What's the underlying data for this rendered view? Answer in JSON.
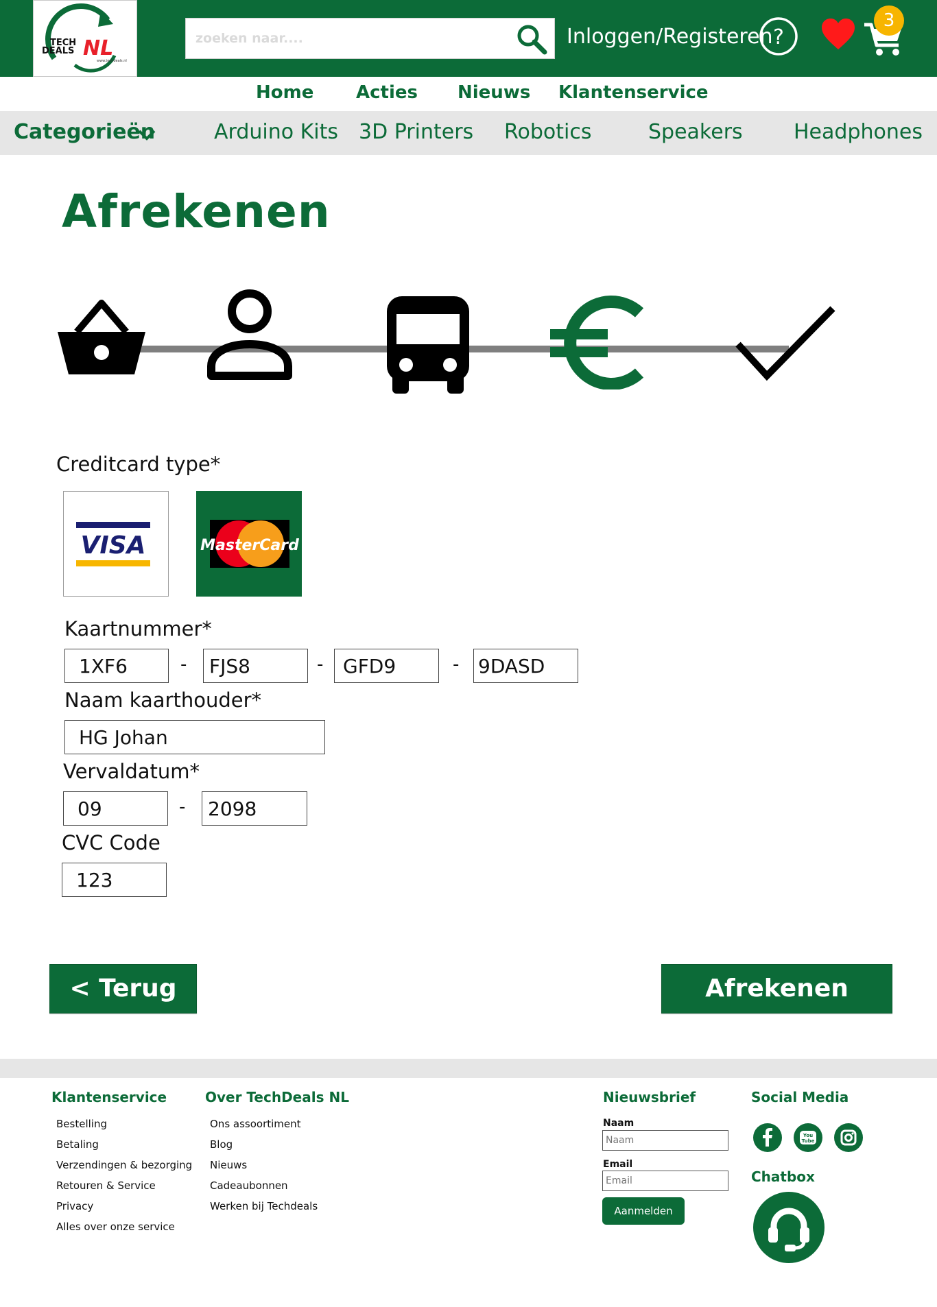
{
  "colors": {
    "brand": "#0c6b38",
    "badge": "#f7b500",
    "heart": "#ff1a1a",
    "step_line": "#7f7f7f"
  },
  "header": {
    "logo": {
      "text_top": "TECH",
      "text_bottom": "DEALS",
      "brand": "NL",
      "url_text": "www.techdeals.nl"
    },
    "search": {
      "placeholder": "zoeken naar....",
      "icon": "search-icon"
    },
    "login_label": "Inloggen/Registeren",
    "cart_count": "3",
    "icons": [
      "help-icon",
      "heart-icon",
      "cart-icon"
    ]
  },
  "nav": {
    "items": [
      {
        "label": "Home"
      },
      {
        "label": "Acties"
      },
      {
        "label": "Nieuws"
      },
      {
        "label": "Klantenservice"
      }
    ]
  },
  "categories": {
    "title": "Categorieën",
    "items": [
      {
        "label": "Arduino Kits"
      },
      {
        "label": "3D Printers"
      },
      {
        "label": "Robotics"
      },
      {
        "label": "Speakers"
      },
      {
        "label": "Headphones"
      }
    ]
  },
  "page": {
    "title": "Afrekenen"
  },
  "steps": {
    "icons": [
      "basket-icon",
      "user-icon",
      "bus-icon",
      "euro-icon",
      "checkmark-icon"
    ],
    "active_index": 3
  },
  "form": {
    "card_type_label": "Creditcard type*",
    "card_types": [
      {
        "name": "VISA",
        "selected": false
      },
      {
        "name": "MasterCard",
        "selected": true
      }
    ],
    "card_number_label": "Kaartnummer*",
    "card_number": [
      "1XF6",
      "FJS8",
      "GFD9",
      "9DASD"
    ],
    "holder_label": "Naam kaarthouder*",
    "holder": "HG Johan",
    "expiry_label": "Vervaldatum*",
    "expiry_month": "09",
    "expiry_year": "2098",
    "cvc_label": "CVC Code",
    "cvc": "123",
    "separator": "-"
  },
  "buttons": {
    "back": "< Terug",
    "pay": "Afrekenen"
  },
  "footer": {
    "customer_service": {
      "title": "Klantenservice",
      "links": [
        "Bestelling",
        "Betaling",
        "Verzendingen & bezorging",
        "Retouren & Service",
        "Privacy",
        "Alles over onze service"
      ]
    },
    "about": {
      "title": "Over TechDeals NL",
      "links": [
        "Ons assoortiment",
        "Blog",
        "Nieuws",
        "Cadeaubonnen",
        "Werken bij Techdeals"
      ]
    },
    "newsletter": {
      "title": "Nieuwsbrief",
      "name_label": "Naam",
      "name_placeholder": "Naam",
      "email_label": "Email",
      "email_placeholder": "Email",
      "button": "Aanmelden"
    },
    "social": {
      "title": "Social Media",
      "icons": [
        "facebook-icon",
        "youtube-icon",
        "instagram-icon"
      ],
      "youtube_text_top": "You",
      "youtube_text_bottom": "Tube"
    },
    "chatbox": {
      "title": "Chatbox",
      "icon": "headset-icon"
    }
  }
}
